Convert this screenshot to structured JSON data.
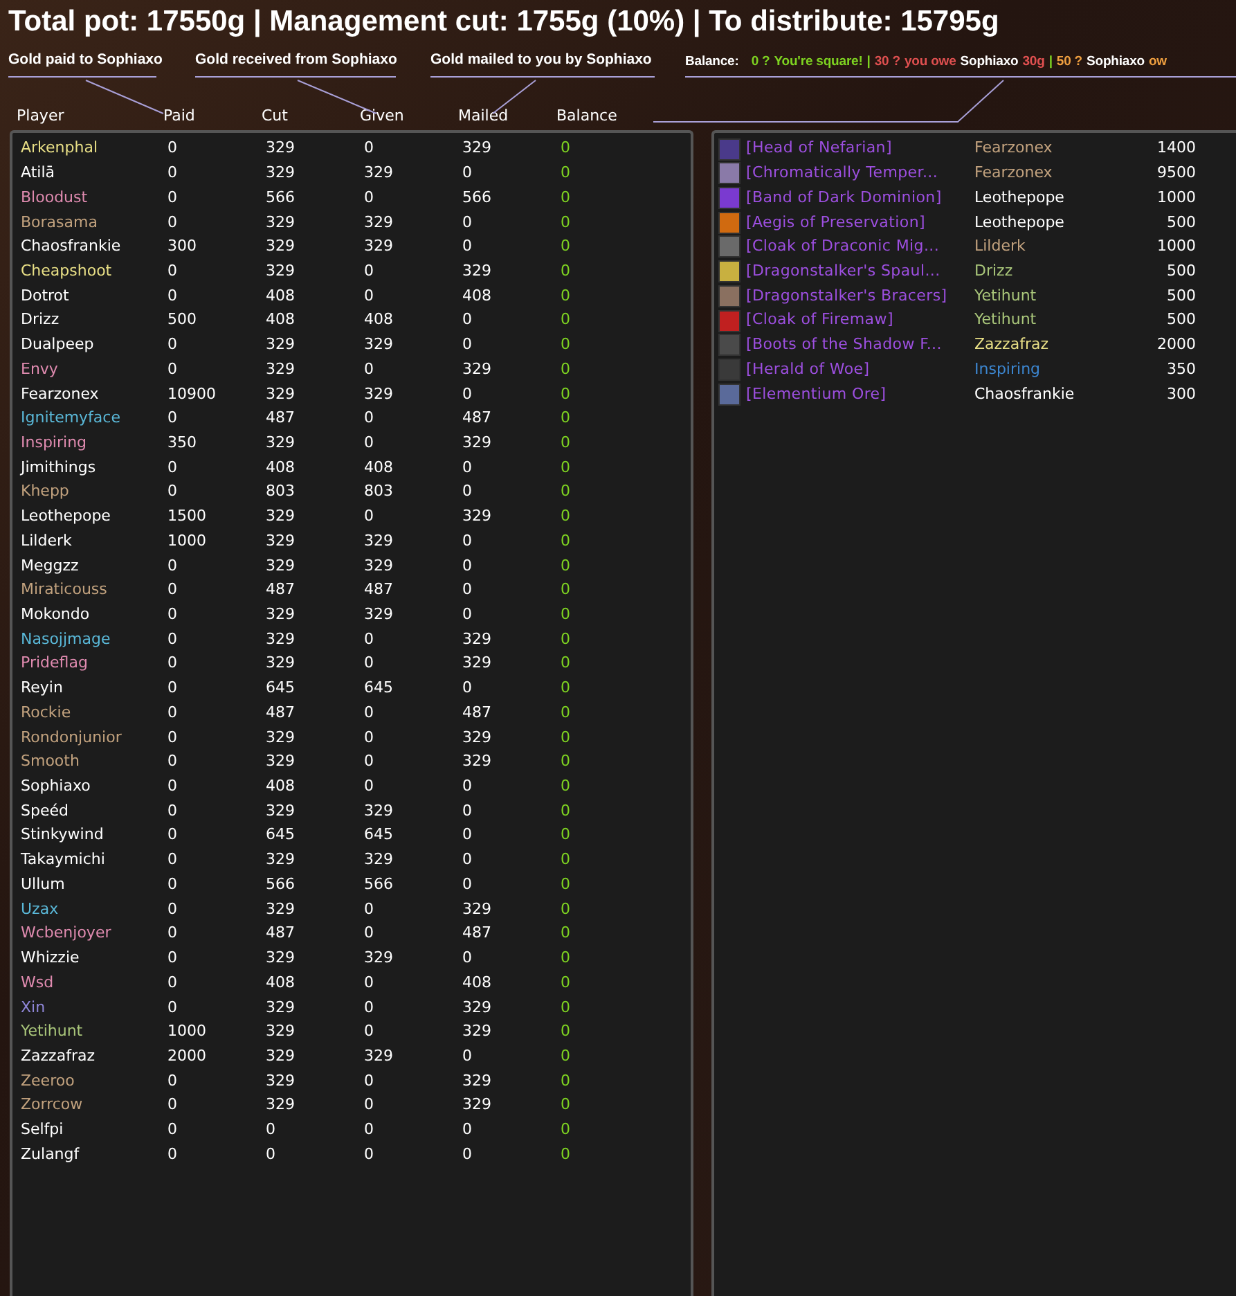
{
  "summary": "Total pot: 17550g | Management cut: 1755g (10%) | To distribute: 15795g",
  "labels": [
    "Gold paid to Sophiaxo",
    "Gold received from Sophiaxo",
    "Gold mailed to you by Sophiaxo"
  ],
  "legend": {
    "label": "Balance:",
    "separator": "|",
    "entries": [
      {
        "kind": "even",
        "value": "0 ?",
        "text": "You're square!"
      },
      {
        "kind": "owe",
        "value": "30 ?",
        "text": "you owe",
        "name": "Sophiaxo",
        "amount": "30g"
      },
      {
        "kind": "owed",
        "value": "50 ?",
        "name": "Sophiaxo",
        "text": "ow"
      }
    ]
  },
  "columns": [
    "Player",
    "Paid",
    "Cut",
    "Given",
    "Mailed",
    "Balance"
  ],
  "players": [
    {
      "name": "Arkenphal",
      "color": "#e8df86",
      "paid": "0",
      "cut": "329",
      "given": "0",
      "mailed": "329",
      "balance": "0"
    },
    {
      "name": "Atilā",
      "color": "#ffffff",
      "paid": "0",
      "cut": "329",
      "given": "329",
      "mailed": "0",
      "balance": "0"
    },
    {
      "name": "Bloodust",
      "color": "#e08bb0",
      "paid": "0",
      "cut": "566",
      "given": "0",
      "mailed": "566",
      "balance": "0"
    },
    {
      "name": "Borasama",
      "color": "#c2a27e",
      "paid": "0",
      "cut": "329",
      "given": "329",
      "mailed": "0",
      "balance": "0"
    },
    {
      "name": "Chaosfrankie",
      "color": "#ffffff",
      "paid": "300",
      "cut": "329",
      "given": "329",
      "mailed": "0",
      "balance": "0"
    },
    {
      "name": "Cheapshoot",
      "color": "#e8df86",
      "paid": "0",
      "cut": "329",
      "given": "0",
      "mailed": "329",
      "balance": "0"
    },
    {
      "name": "Dotrot",
      "color": "#ffffff",
      "paid": "0",
      "cut": "408",
      "given": "0",
      "mailed": "408",
      "balance": "0"
    },
    {
      "name": "Drizz",
      "color": "#ffffff",
      "paid": "500",
      "cut": "408",
      "given": "408",
      "mailed": "0",
      "balance": "0"
    },
    {
      "name": "Dualpeep",
      "color": "#ffffff",
      "paid": "0",
      "cut": "329",
      "given": "329",
      "mailed": "0",
      "balance": "0"
    },
    {
      "name": "Envy",
      "color": "#e08bb0",
      "paid": "0",
      "cut": "329",
      "given": "0",
      "mailed": "329",
      "balance": "0"
    },
    {
      "name": "Fearzonex",
      "color": "#ffffff",
      "paid": "10900",
      "cut": "329",
      "given": "329",
      "mailed": "0",
      "balance": "0"
    },
    {
      "name": "Ignitemyface",
      "color": "#5ab8d8",
      "paid": "0",
      "cut": "487",
      "given": "0",
      "mailed": "487",
      "balance": "0"
    },
    {
      "name": "Inspiring",
      "color": "#e08bb0",
      "paid": "350",
      "cut": "329",
      "given": "0",
      "mailed": "329",
      "balance": "0"
    },
    {
      "name": "Jimithings",
      "color": "#ffffff",
      "paid": "0",
      "cut": "408",
      "given": "408",
      "mailed": "0",
      "balance": "0"
    },
    {
      "name": "Khepp",
      "color": "#c2a27e",
      "paid": "0",
      "cut": "803",
      "given": "803",
      "mailed": "0",
      "balance": "0"
    },
    {
      "name": "Leothepope",
      "color": "#ffffff",
      "paid": "1500",
      "cut": "329",
      "given": "0",
      "mailed": "329",
      "balance": "0"
    },
    {
      "name": "Lilderk",
      "color": "#ffffff",
      "paid": "1000",
      "cut": "329",
      "given": "329",
      "mailed": "0",
      "balance": "0"
    },
    {
      "name": "Meggzz",
      "color": "#ffffff",
      "paid": "0",
      "cut": "329",
      "given": "329",
      "mailed": "0",
      "balance": "0"
    },
    {
      "name": "Miraticouss",
      "color": "#c2a27e",
      "paid": "0",
      "cut": "487",
      "given": "487",
      "mailed": "0",
      "balance": "0"
    },
    {
      "name": "Mokondo",
      "color": "#ffffff",
      "paid": "0",
      "cut": "329",
      "given": "329",
      "mailed": "0",
      "balance": "0"
    },
    {
      "name": "Nasojjmage",
      "color": "#5ab8d8",
      "paid": "0",
      "cut": "329",
      "given": "0",
      "mailed": "329",
      "balance": "0"
    },
    {
      "name": "Prideflag",
      "color": "#e08bb0",
      "paid": "0",
      "cut": "329",
      "given": "0",
      "mailed": "329",
      "balance": "0"
    },
    {
      "name": "Reyin",
      "color": "#ffffff",
      "paid": "0",
      "cut": "645",
      "given": "645",
      "mailed": "0",
      "balance": "0"
    },
    {
      "name": "Rockie",
      "color": "#c2a27e",
      "paid": "0",
      "cut": "487",
      "given": "0",
      "mailed": "487",
      "balance": "0"
    },
    {
      "name": "Rondonjunior",
      "color": "#c2a27e",
      "paid": "0",
      "cut": "329",
      "given": "0",
      "mailed": "329",
      "balance": "0"
    },
    {
      "name": "Smooth",
      "color": "#c2a27e",
      "paid": "0",
      "cut": "329",
      "given": "0",
      "mailed": "329",
      "balance": "0"
    },
    {
      "name": "Sophiaxo",
      "color": "#ffffff",
      "paid": "0",
      "cut": "408",
      "given": "0",
      "mailed": "0",
      "balance": "0"
    },
    {
      "name": "Speéd",
      "color": "#ffffff",
      "paid": "0",
      "cut": "329",
      "given": "329",
      "mailed": "0",
      "balance": "0"
    },
    {
      "name": "Stinkywind",
      "color": "#ffffff",
      "paid": "0",
      "cut": "645",
      "given": "645",
      "mailed": "0",
      "balance": "0"
    },
    {
      "name": "Takaymichi",
      "color": "#ffffff",
      "paid": "0",
      "cut": "329",
      "given": "329",
      "mailed": "0",
      "balance": "0"
    },
    {
      "name": "Ullum",
      "color": "#ffffff",
      "paid": "0",
      "cut": "566",
      "given": "566",
      "mailed": "0",
      "balance": "0"
    },
    {
      "name": "Uzax",
      "color": "#5ab8d8",
      "paid": "0",
      "cut": "329",
      "given": "0",
      "mailed": "329",
      "balance": "0"
    },
    {
      "name": "Wcbenjoyer",
      "color": "#e08bb0",
      "paid": "0",
      "cut": "487",
      "given": "0",
      "mailed": "487",
      "balance": "0"
    },
    {
      "name": "Whizzie",
      "color": "#ffffff",
      "paid": "0",
      "cut": "329",
      "given": "329",
      "mailed": "0",
      "balance": "0"
    },
    {
      "name": "Wsd",
      "color": "#e08bb0",
      "paid": "0",
      "cut": "408",
      "given": "0",
      "mailed": "408",
      "balance": "0"
    },
    {
      "name": "Xin",
      "color": "#8f86d8",
      "paid": "0",
      "cut": "329",
      "given": "0",
      "mailed": "329",
      "balance": "0"
    },
    {
      "name": "Yetihunt",
      "color": "#a9c67a",
      "paid": "1000",
      "cut": "329",
      "given": "0",
      "mailed": "329",
      "balance": "0"
    },
    {
      "name": "Zazzafraz",
      "color": "#ffffff",
      "paid": "2000",
      "cut": "329",
      "given": "329",
      "mailed": "0",
      "balance": "0"
    },
    {
      "name": "Zeeroo",
      "color": "#c2a27e",
      "paid": "0",
      "cut": "329",
      "given": "0",
      "mailed": "329",
      "balance": "0"
    },
    {
      "name": "Zorrcow",
      "color": "#c2a27e",
      "paid": "0",
      "cut": "329",
      "given": "0",
      "mailed": "329",
      "balance": "0"
    },
    {
      "name": "Selfpi",
      "color": "#ffffff",
      "paid": "0",
      "cut": "0",
      "given": "0",
      "mailed": "0",
      "balance": "0"
    },
    {
      "name": "Zulangf",
      "color": "#ffffff",
      "paid": "0",
      "cut": "0",
      "given": "0",
      "mailed": "0",
      "balance": "0"
    }
  ],
  "loot": [
    {
      "item": "[Head of Nefarian]",
      "winner": "Fearzonex",
      "color": "#c2a27e",
      "amount": "1400"
    },
    {
      "item": "[Chromatically Temper...",
      "winner": "Fearzonex",
      "color": "#c2a27e",
      "amount": "9500"
    },
    {
      "item": "[Band of Dark Dominion]",
      "winner": "Leothepope",
      "color": "#ffffff",
      "amount": "1000"
    },
    {
      "item": "[Aegis of Preservation]",
      "winner": "Leothepope",
      "color": "#ffffff",
      "amount": "500"
    },
    {
      "item": "[Cloak of Draconic Mig...",
      "winner": "Lilderk",
      "color": "#c2a27e",
      "amount": "1000"
    },
    {
      "item": "[Dragonstalker's Spaul...",
      "winner": "Drizz",
      "color": "#a9c67a",
      "amount": "500"
    },
    {
      "item": "[Dragonstalker's Bracers]",
      "winner": "Yetihunt",
      "color": "#a9c67a",
      "amount": "500"
    },
    {
      "item": "[Cloak of Firemaw]",
      "winner": "Yetihunt",
      "color": "#a9c67a",
      "amount": "500"
    },
    {
      "item": "[Boots of the Shadow F...",
      "winner": "Zazzafraz",
      "color": "#e8df86",
      "amount": "2000"
    },
    {
      "item": "[Herald of Woe]",
      "winner": "Inspiring",
      "color": "#3c86d0",
      "amount": "350"
    },
    {
      "item": "[Elementium Ore]",
      "winner": "Chaosfrankie",
      "color": "#ffffff",
      "amount": "300"
    }
  ]
}
